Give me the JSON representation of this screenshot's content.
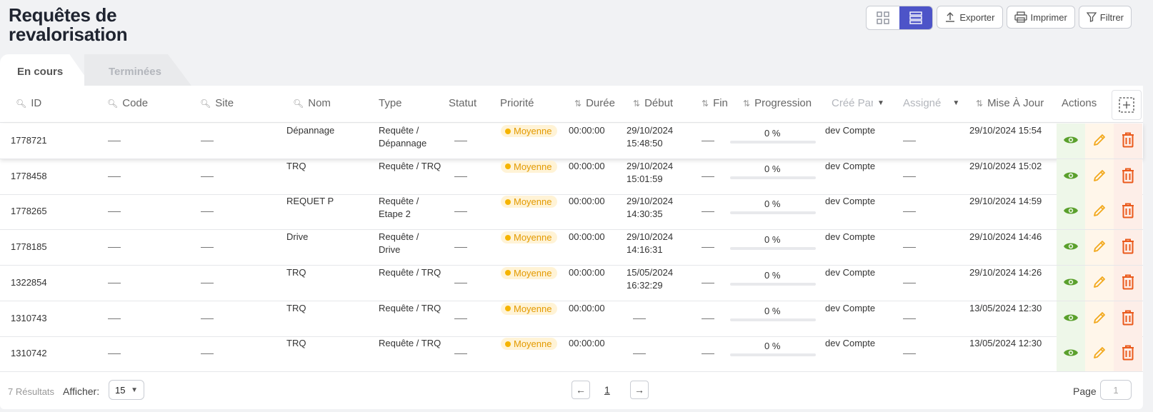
{
  "page": {
    "title_line1": "Requêtes de",
    "title_line2": "revalorisation"
  },
  "toolbar": {
    "export_label": "Exporter",
    "print_label": "Imprimer",
    "filter_label": "Filtrer",
    "accent_color": "#4d54c8"
  },
  "tabs": [
    {
      "label": "En cours",
      "active": true
    },
    {
      "label": "Terminées",
      "active": false
    }
  ],
  "table": {
    "headers": {
      "id": "ID",
      "code": "Code",
      "site": "Site",
      "nom": "Nom",
      "type": "Type",
      "statut": "Statut",
      "priorite": "Priorité",
      "duree": "Durée",
      "debut": "Début",
      "fin": "Fin",
      "progression": "Progression",
      "cree_par": "Créé Par",
      "assigne": "Assigné",
      "mise_a_jour": "Mise À Jour",
      "actions": "Actions"
    },
    "rows": [
      {
        "id": "1778721",
        "nom": "Dépannage",
        "type_l1": "Requête /",
        "type_l2": "Dépannage",
        "priorite": "Moyenne",
        "duree": "00:00:00",
        "debut_l1": "29/10/2024",
        "debut_l2": "15:48:50",
        "progression": "0 %",
        "progress": 0,
        "cree_par": "dev Compte",
        "mise_a_jour": "29/10/2024 15:54"
      },
      {
        "id": "1778458",
        "nom": "TRQ",
        "type_l1": "Requête / TRQ",
        "type_l2": "",
        "priorite": "Moyenne",
        "duree": "00:00:00",
        "debut_l1": "29/10/2024",
        "debut_l2": "15:01:59",
        "progression": "0 %",
        "progress": 0,
        "cree_par": "dev Compte",
        "mise_a_jour": "29/10/2024 15:02"
      },
      {
        "id": "1778265",
        "nom": "REQUET P",
        "type_l1": "Requête /",
        "type_l2": "Etape 2",
        "priorite": "Moyenne",
        "duree": "00:00:00",
        "debut_l1": "29/10/2024",
        "debut_l2": "14:30:35",
        "progression": "0 %",
        "progress": 0,
        "cree_par": "dev Compte",
        "mise_a_jour": "29/10/2024 14:59"
      },
      {
        "id": "1778185",
        "nom": "Drive",
        "type_l1": "Requête /",
        "type_l2": "Drive",
        "priorite": "Moyenne",
        "duree": "00:00:00",
        "debut_l1": "29/10/2024",
        "debut_l2": "14:16:31",
        "progression": "0 %",
        "progress": 0,
        "cree_par": "dev Compte",
        "mise_a_jour": "29/10/2024 14:46"
      },
      {
        "id": "1322854",
        "nom": "TRQ",
        "type_l1": "Requête / TRQ",
        "type_l2": "",
        "priorite": "Moyenne",
        "duree": "00:00:00",
        "debut_l1": "15/05/2024",
        "debut_l2": "16:32:29",
        "progression": "0 %",
        "progress": 0,
        "cree_par": "dev Compte",
        "mise_a_jour": "29/10/2024 14:26"
      },
      {
        "id": "1310743",
        "nom": "TRQ",
        "type_l1": "Requête / TRQ",
        "type_l2": "",
        "priorite": "Moyenne",
        "duree": "00:00:00",
        "debut_l1": "",
        "debut_l2": "",
        "progression": "0 %",
        "progress": 0,
        "cree_par": "dev Compte",
        "mise_a_jour": "13/05/2024 12:30"
      },
      {
        "id": "1310742",
        "nom": "TRQ",
        "type_l1": "Requête / TRQ",
        "type_l2": "",
        "priorite": "Moyenne",
        "duree": "00:00:00",
        "debut_l1": "",
        "debut_l2": "",
        "progression": "0 %",
        "progress": 0,
        "cree_par": "dev Compte",
        "mise_a_jour": "13/05/2024 12:30"
      }
    ]
  },
  "footer": {
    "results": "7 Résultats",
    "show_label": "Afficher:",
    "page_size": "15",
    "current_page": "1",
    "page_label": "Page",
    "page_input": "1"
  }
}
